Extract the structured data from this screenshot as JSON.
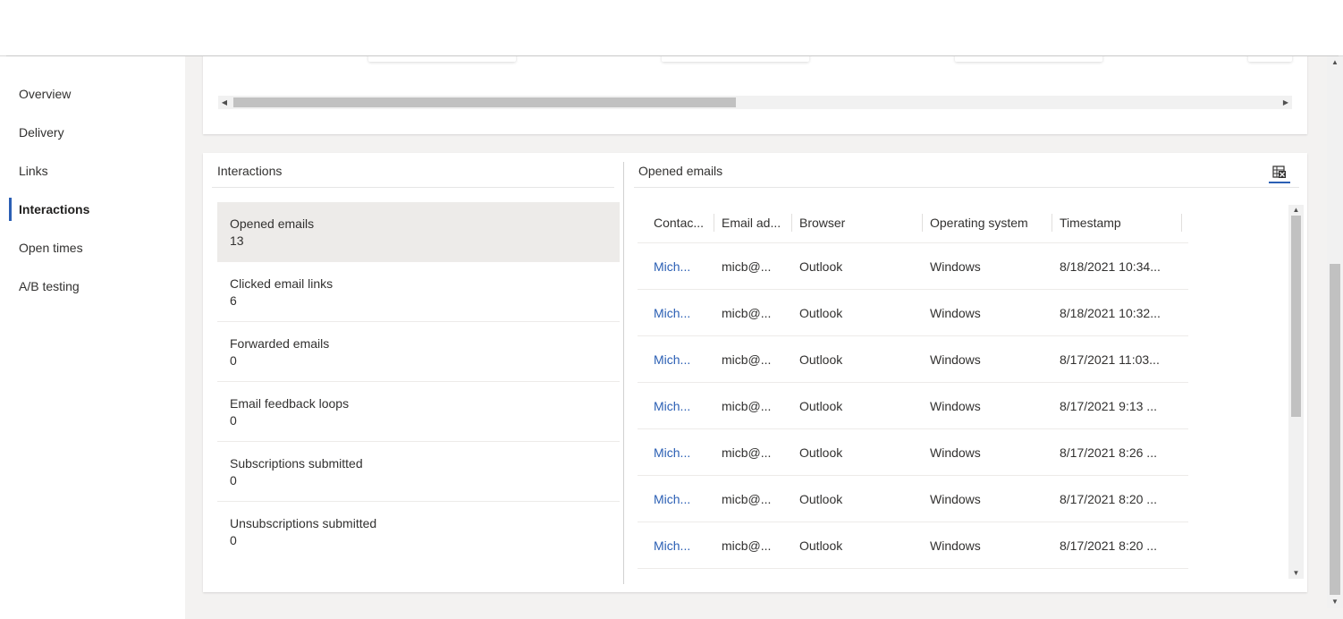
{
  "sidebar": {
    "items": [
      {
        "label": "Overview",
        "active": false
      },
      {
        "label": "Delivery",
        "active": false
      },
      {
        "label": "Links",
        "active": false
      },
      {
        "label": "Interactions",
        "active": true
      },
      {
        "label": "Open times",
        "active": false
      },
      {
        "label": "A/B testing",
        "active": false
      }
    ]
  },
  "interactions": {
    "title": "Interactions",
    "metrics": [
      {
        "label": "Opened emails",
        "value": "13",
        "selected": true
      },
      {
        "label": "Clicked email links",
        "value": "6",
        "selected": false
      },
      {
        "label": "Forwarded emails",
        "value": "0",
        "selected": false
      },
      {
        "label": "Email feedback loops",
        "value": "0",
        "selected": false
      },
      {
        "label": "Subscriptions submitted",
        "value": "0",
        "selected": false
      },
      {
        "label": "Unsubscriptions submitted",
        "value": "0",
        "selected": false
      }
    ]
  },
  "opened_emails": {
    "title": "Opened emails",
    "export_icon": "excel-export-icon",
    "columns": [
      "Contac...",
      "Email ad...",
      "Browser",
      "Operating system",
      "Timestamp"
    ],
    "rows": [
      [
        "Mich...",
        "micb@...",
        "Outlook",
        "Windows",
        "8/18/2021 10:34..."
      ],
      [
        "Mich...",
        "micb@...",
        "Outlook",
        "Windows",
        "8/18/2021 10:32..."
      ],
      [
        "Mich...",
        "micb@...",
        "Outlook",
        "Windows",
        "8/17/2021 11:03..."
      ],
      [
        "Mich...",
        "micb@...",
        "Outlook",
        "Windows",
        "8/17/2021 9:13 ..."
      ],
      [
        "Mich...",
        "micb@...",
        "Outlook",
        "Windows",
        "8/17/2021 8:26 ..."
      ],
      [
        "Mich...",
        "micb@...",
        "Outlook",
        "Windows",
        "8/17/2021 8:20 ..."
      ],
      [
        "Mich...",
        "micb@...",
        "Outlook",
        "Windows",
        "8/17/2021 8:20 ..."
      ]
    ]
  },
  "colors": {
    "accent": "#2b5fb4",
    "selected_row": "#edebe9",
    "page_background": "#f3f2f1"
  }
}
